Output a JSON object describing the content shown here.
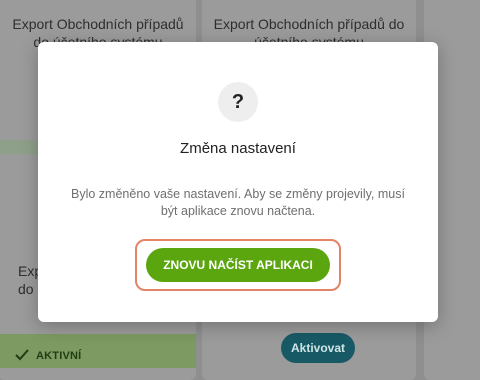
{
  "background": {
    "card_left_title": "Export Obchodních případů do účetního systému",
    "card_right_title": "Export Obchodních případů do účetního systému",
    "card_left_title2": "Expor\ndo",
    "status_label": "AKTIVNÍ",
    "activate_button": "Aktivovat"
  },
  "dialog": {
    "icon": "question-icon",
    "icon_glyph": "?",
    "title": "Změna nastavení",
    "message": "Bylo změněno vaše nastavení. Aby se změny projevily, musí být aplikace znovu načtena.",
    "primary_button": "ZNOVU NAČÍST APLIKACI"
  },
  "colors": {
    "primary": "#5ba60f",
    "focus_ring": "#e38466",
    "activate": "#175a66"
  }
}
